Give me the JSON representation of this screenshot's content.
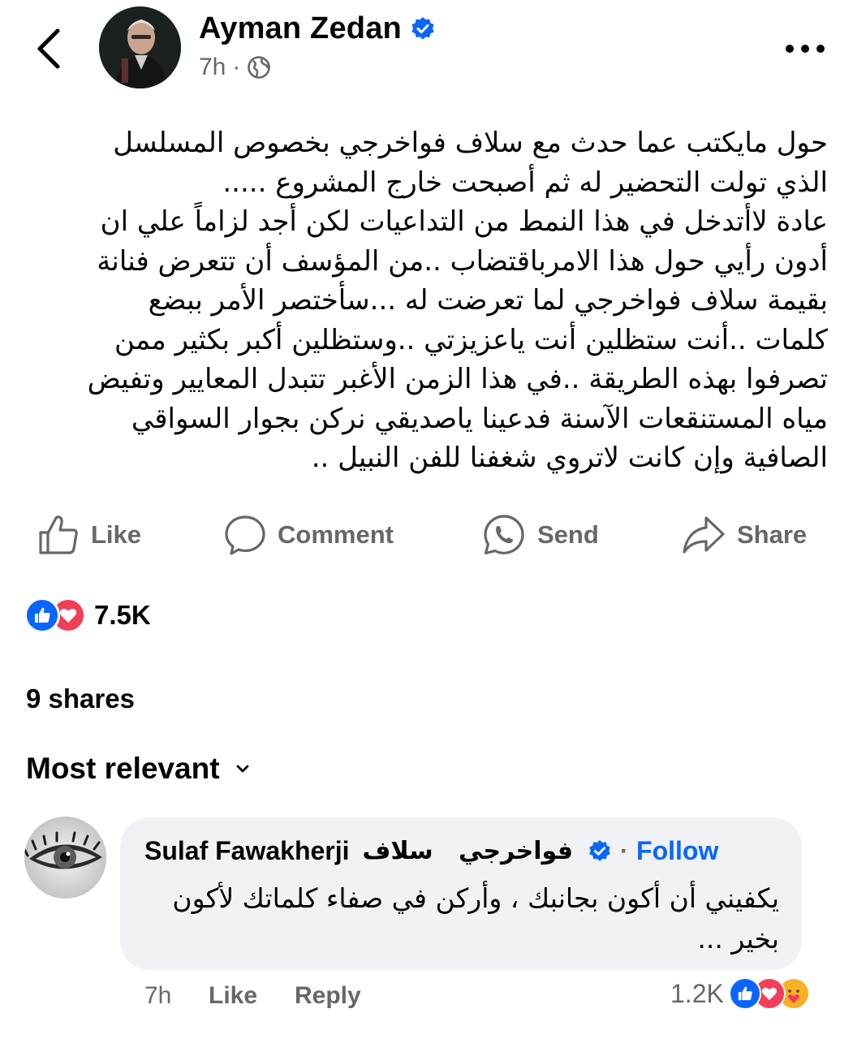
{
  "header": {
    "author_name": "Ayman Zedan",
    "verified": true,
    "time": "7h",
    "separator": "·",
    "audience_icon": "globe-icon",
    "more_icon": "more-horizontal-icon",
    "back_icon": "chevron-left-icon"
  },
  "post": {
    "lines": [
      "حول مايكتب عما حدث مع سلاف فواخرجي بخصوص المسلسل",
      "الذي تولت التحضير له ثم أصبحت خارج المشروع .....",
      "عادة لاأتدخل في هذا النمط من التداعيات لكن أجد لزاماً علي ان",
      "أدون رأيي حول هذا الامرباقتضاب ..من المؤسف أن تتعرض فنانة",
      "بقيمة سلاف فواخرجي لما تعرضت له ...سأختصر الأمر ببضع",
      "كلمات ..أنت ستظلين أنت ياعزيزتي ..وستظلين أكبر بكثير ممن",
      "تصرفوا بهذه الطريقة ..في هذا الزمن الأغبر تتبدل المعايير وتفيض",
      "مياه المستنقعات الآسنة فدعينا ياصديقي نركن بجوار السواقي",
      "الصافية وإن كانت  لاتروي شغفنا للفن النبيل .."
    ]
  },
  "actions": {
    "like": "Like",
    "comment": "Comment",
    "send": "Send",
    "share": "Share"
  },
  "stats": {
    "reaction_count": "7.5K",
    "shares": "9 shares"
  },
  "sort": {
    "label": "Most relevant",
    "icon": "chevron-down-icon"
  },
  "comment": {
    "author": "Sulaf Fawakherji",
    "author_ar_1": "فواخرجي",
    "author_ar_2": "سلاف",
    "verified": true,
    "dot": "·",
    "follow": "Follow",
    "lines": [
      "يكفيني أن أكون بجانبك ، وأركن في صفاء كلماتك لأكون",
      "بخير ..."
    ],
    "time": "7h",
    "like": "Like",
    "reply": "Reply",
    "reaction_count": "1.2K"
  },
  "colors": {
    "primary_text": "#050505",
    "secondary_text": "#65676b",
    "link_blue": "#0866ff",
    "verified_blue": "#0866ff",
    "bubble_bg": "#f0f2f5",
    "love_red": "#f33e58",
    "care_yellow": "#f7b125"
  }
}
